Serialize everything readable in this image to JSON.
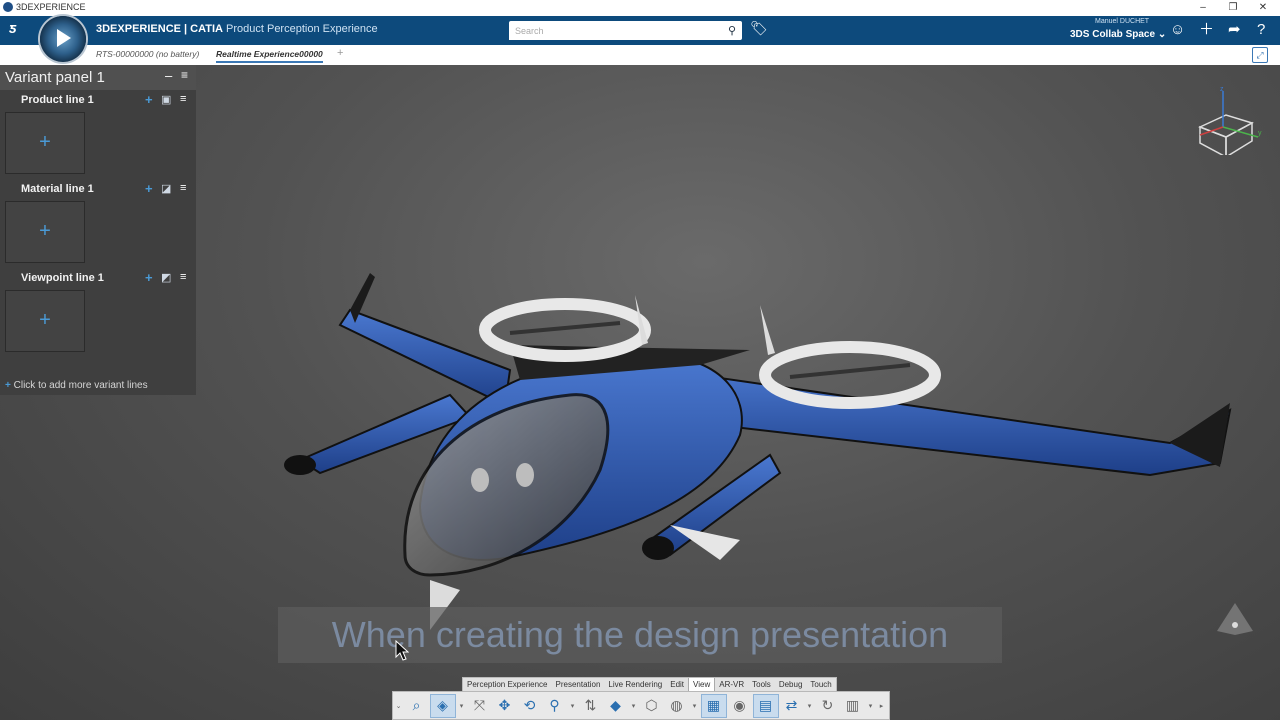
{
  "os": {
    "title": "3DEXPERIENCE"
  },
  "header": {
    "brand_bold": "3DEXPERIENCE | CATIA",
    "brand_sub": "Product Perception Experience",
    "search_placeholder": "Search",
    "user_name": "Manuel DUCHET",
    "space_name": "3DS Collab Space"
  },
  "tabs": [
    {
      "label": "RTS-00000000 (no battery)",
      "active": false
    },
    {
      "label": "Realtime Experience00000",
      "active": true
    }
  ],
  "variant_panel": {
    "title": "Variant panel 1",
    "lines": [
      {
        "label": "Product line 1"
      },
      {
        "label": "Material line 1"
      },
      {
        "label": "Viewpoint line 1"
      }
    ],
    "slot_plus": "+",
    "add_more": "Click to add more variant lines"
  },
  "caption": "When creating the design presentation",
  "section_tabs": [
    "Perception Experience",
    "Presentation",
    "Live Rendering",
    "Edit",
    "View",
    "AR-VR",
    "Tools",
    "Debug",
    "Touch"
  ],
  "active_section_tab": "View",
  "toolbar_icons": [
    "zoom-area-icon",
    "view-cube-icon",
    "fit-all-icon",
    "pan-icon",
    "rotate-icon",
    "zoom-icon",
    "normal-view-icon",
    "iso-view-icon",
    "render-style-icon",
    "hide-show-icon",
    "display-icon",
    "camera-icon",
    "shading-icon",
    "swap-icon",
    "refresh-icon",
    "layout-icon",
    "more-icon"
  ],
  "colors": {
    "header": "#0d4a7c",
    "accent": "#3b78b5",
    "panel": "#3f3f3f",
    "aircraft_blue": "#2f5fb8"
  }
}
